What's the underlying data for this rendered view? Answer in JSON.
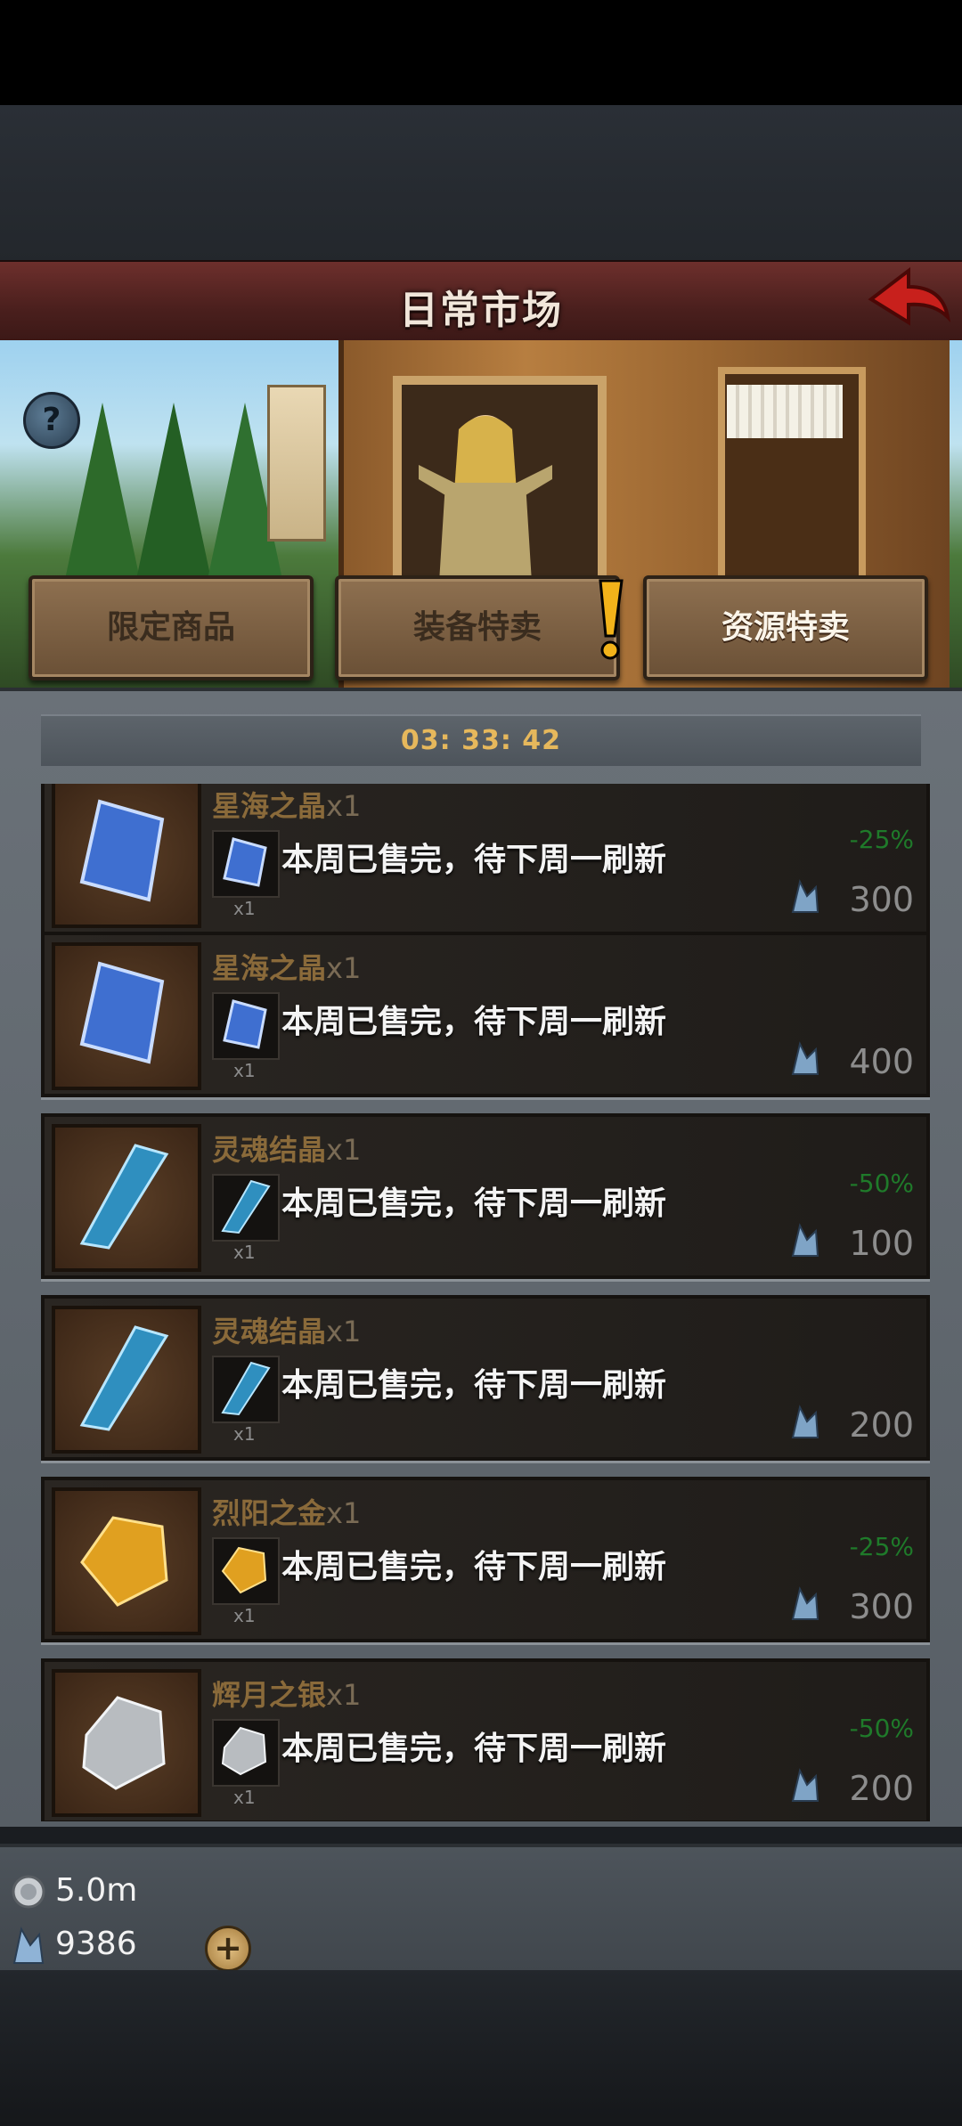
{
  "header": {
    "title": "日常市场"
  },
  "tabs": [
    {
      "label": "限定商品"
    },
    {
      "label": "装备特卖"
    },
    {
      "label": "资源特卖"
    }
  ],
  "timer": "03: 33: 42",
  "items": [
    {
      "name": "星海之晶",
      "qty": "x1",
      "mini_qty": "x1",
      "status": "本周已售完，待下周一刷新",
      "discount": "-25%",
      "price": "300",
      "color": "#3f6fd0"
    },
    {
      "name": "星海之晶",
      "qty": "x1",
      "mini_qty": "x1",
      "status": "本周已售完，待下周一刷新",
      "discount": "",
      "price": "400",
      "color": "#3f6fd0"
    },
    {
      "name": "灵魂结晶",
      "qty": "x1",
      "mini_qty": "x1",
      "status": "本周已售完，待下周一刷新",
      "discount": "-50%",
      "price": "100",
      "color": "#2f8fbf"
    },
    {
      "name": "灵魂结晶",
      "qty": "x1",
      "mini_qty": "x1",
      "status": "本周已售完，待下周一刷新",
      "discount": "",
      "price": "200",
      "color": "#2f8fbf"
    },
    {
      "name": "烈阳之金",
      "qty": "x1",
      "mini_qty": "x1",
      "status": "本周已售完，待下周一刷新",
      "discount": "-25%",
      "price": "300",
      "color": "#e0a020"
    },
    {
      "name": "辉月之银",
      "qty": "x1",
      "mini_qty": "x1",
      "status": "本周已售完，待下周一刷新",
      "discount": "-50%",
      "price": "200",
      "color": "#b8bcc0"
    }
  ],
  "currency": {
    "silver": "5.0m",
    "gems": "9386",
    "add_label": "+"
  }
}
